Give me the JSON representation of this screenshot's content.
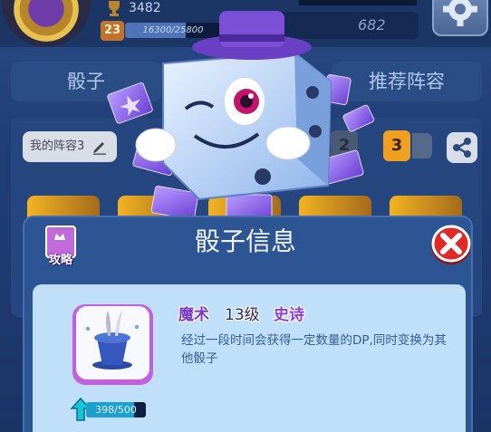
{
  "profile": {
    "trophies": "3482",
    "level": "23",
    "xp_text": "16300/25800",
    "xp_progress": 0.632
  },
  "currency": {
    "amount": "682"
  },
  "tabs": [
    {
      "label": "骰子"
    },
    {
      "label": "推荐阵容"
    }
  ],
  "deck": {
    "name": "我的阵容3",
    "buttons": [
      "2",
      "3"
    ]
  },
  "modal": {
    "title": "骰子信息",
    "guide_label": "攻略",
    "dice": {
      "name": "魔术",
      "level": "13级",
      "rarity": "史诗",
      "description": "经过一段时间会获得一定数量的DP,同时变换为其他骰子",
      "dp_text": "398/500",
      "dp_progress": 0.796
    }
  },
  "colors": {
    "accent_purple": "#8c3fd6",
    "close_red": "#d62020",
    "modal_blue": "#2e5593",
    "body_light": "#bfe0f8"
  }
}
